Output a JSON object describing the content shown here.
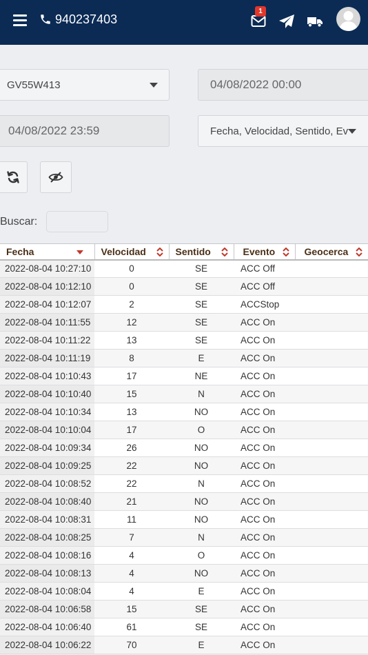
{
  "header": {
    "phone": "940237403",
    "unread_count": "1",
    "icons": [
      "menu-icon",
      "phone-icon",
      "mail-icon",
      "send-icon",
      "truck-icon",
      "user-avatar"
    ],
    "background_color": "#0b2b55",
    "badge_color": "#e2372b"
  },
  "filters": {
    "device": "GV55W413",
    "start_datetime": "04/08/2022 00:00",
    "end_datetime": "04/08/2022 23:59",
    "columns": "Fecha, Velocidad, Sentido, Ev"
  },
  "search": {
    "label": "Buscar:",
    "value": ""
  },
  "table": {
    "headers": [
      "Fecha",
      "Velocidad",
      "Sentido",
      "Evento",
      "Geocerca"
    ],
    "sorted_column": "Fecha",
    "sort_direction": "desc",
    "rows": [
      [
        "2022-08-04 10:27:10",
        "0",
        "SE",
        "ACC Off",
        ""
      ],
      [
        "2022-08-04 10:12:10",
        "0",
        "SE",
        "ACC Off",
        ""
      ],
      [
        "2022-08-04 10:12:07",
        "2",
        "SE",
        "ACCStop",
        ""
      ],
      [
        "2022-08-04 10:11:55",
        "12",
        "SE",
        "ACC On",
        ""
      ],
      [
        "2022-08-04 10:11:22",
        "13",
        "SE",
        "ACC On",
        ""
      ],
      [
        "2022-08-04 10:11:19",
        "8",
        "E",
        "ACC On",
        ""
      ],
      [
        "2022-08-04 10:10:43",
        "17",
        "NE",
        "ACC On",
        ""
      ],
      [
        "2022-08-04 10:10:40",
        "15",
        "N",
        "ACC On",
        ""
      ],
      [
        "2022-08-04 10:10:34",
        "13",
        "NO",
        "ACC On",
        ""
      ],
      [
        "2022-08-04 10:10:04",
        "17",
        "O",
        "ACC On",
        ""
      ],
      [
        "2022-08-04 10:09:34",
        "26",
        "NO",
        "ACC On",
        ""
      ],
      [
        "2022-08-04 10:09:25",
        "22",
        "NO",
        "ACC On",
        ""
      ],
      [
        "2022-08-04 10:08:52",
        "22",
        "N",
        "ACC On",
        ""
      ],
      [
        "2022-08-04 10:08:40",
        "21",
        "NO",
        "ACC On",
        ""
      ],
      [
        "2022-08-04 10:08:31",
        "11",
        "NO",
        "ACC On",
        ""
      ],
      [
        "2022-08-04 10:08:25",
        "7",
        "N",
        "ACC On",
        ""
      ],
      [
        "2022-08-04 10:08:16",
        "4",
        "O",
        "ACC On",
        ""
      ],
      [
        "2022-08-04 10:08:13",
        "4",
        "NO",
        "ACC On",
        ""
      ],
      [
        "2022-08-04 10:08:04",
        "4",
        "E",
        "ACC On",
        ""
      ],
      [
        "2022-08-04 10:06:58",
        "15",
        "SE",
        "ACC On",
        ""
      ],
      [
        "2022-08-04 10:06:40",
        "61",
        "SE",
        "ACC On",
        ""
      ],
      [
        "2022-08-04 10:06:22",
        "70",
        "E",
        "ACC On",
        ""
      ]
    ]
  }
}
